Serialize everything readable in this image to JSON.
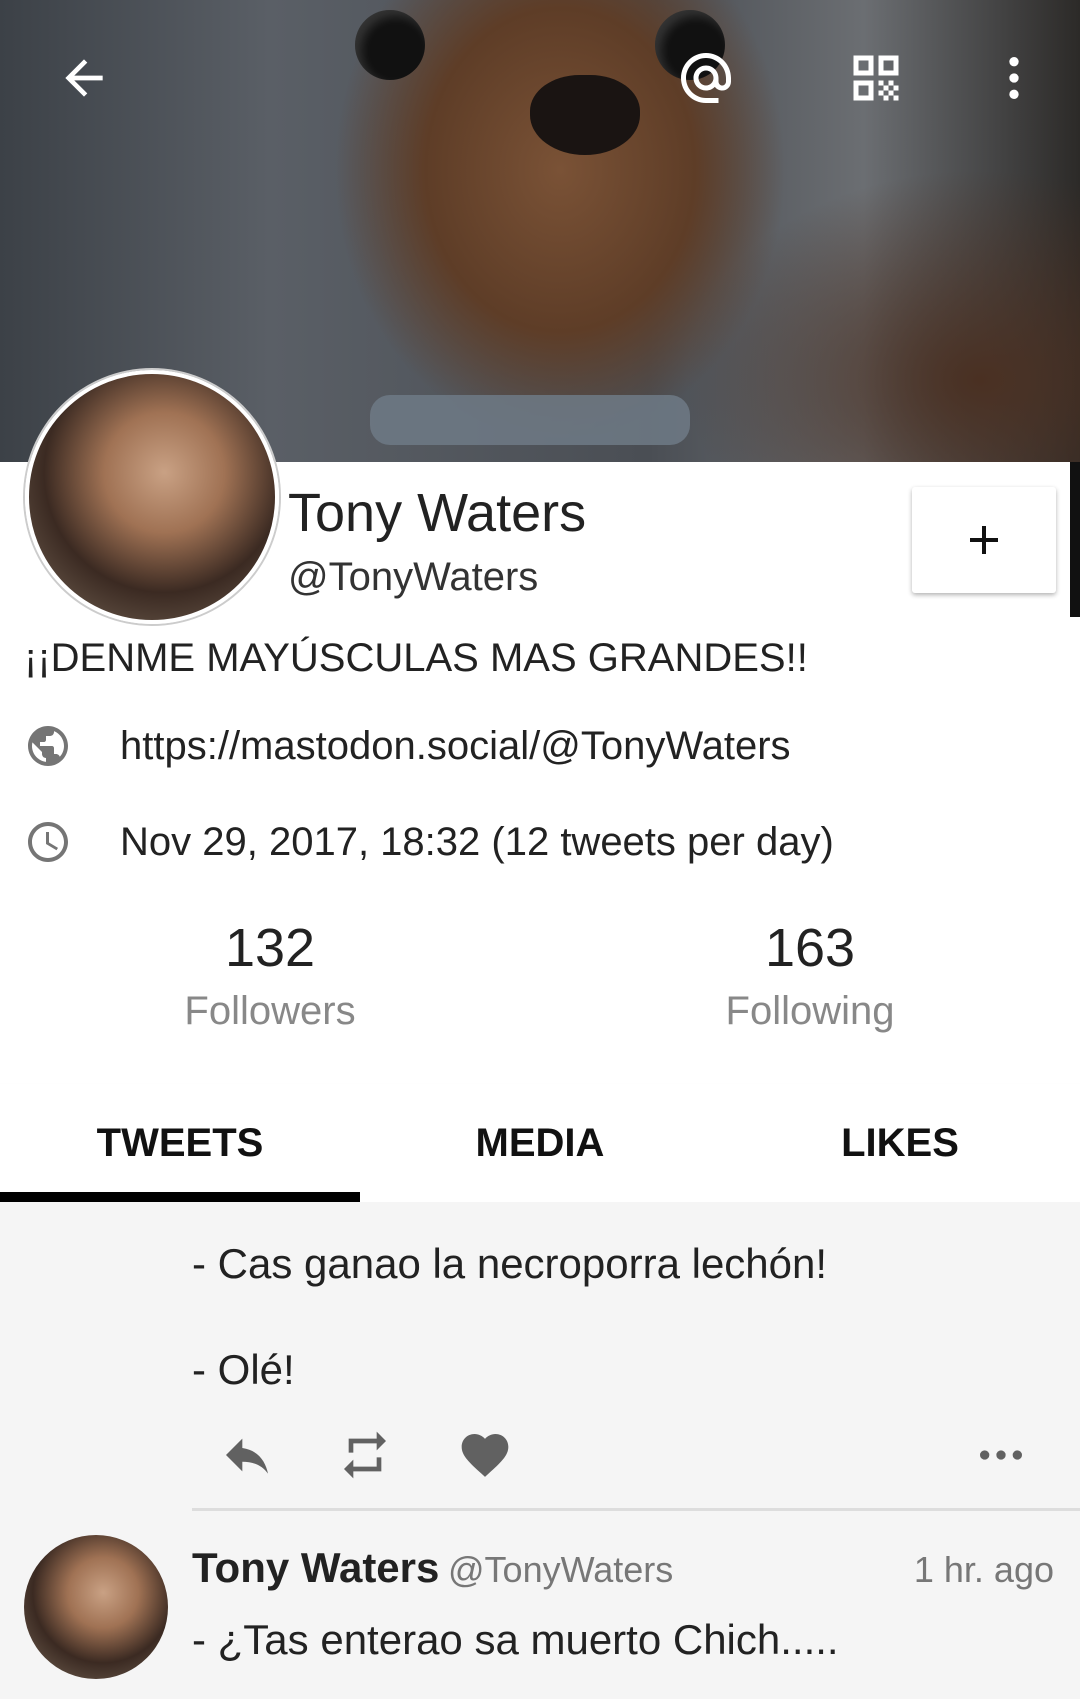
{
  "topbar": {
    "back_icon": "arrow-left-icon",
    "mention_icon": "at-sign-icon",
    "qr_icon": "qr-code-icon",
    "menu_icon": "more-vertical-icon"
  },
  "profile": {
    "display_name": "Tony Waters",
    "handle": "@TonyWaters",
    "follow_button_label": "+",
    "bio": "¡¡DENME MAYÚSCULAS MAS GRANDES!!",
    "website": "https://mastodon.social/@TonyWaters",
    "joined": "Nov 29, 2017, 18:32 (12 tweets per day)"
  },
  "stats": {
    "followers_count": "132",
    "followers_label": "Followers",
    "following_count": "163",
    "following_label": "Following"
  },
  "tabs": [
    {
      "label": "TWEETS",
      "active": true
    },
    {
      "label": "MEDIA",
      "active": false
    },
    {
      "label": "LIKES",
      "active": false
    }
  ],
  "feed": {
    "toot1": {
      "lines": [
        "- Cas ganao la necroporra lechón!",
        "- Olé!"
      ]
    },
    "toot2": {
      "name": "Tony Waters",
      "handle": "@TonyWaters",
      "time": "1 hr. ago",
      "text": "- ¿Tas enterao sa muerto Chich....."
    }
  },
  "colors": {
    "tab_indicator": "#000000",
    "muted_text": "#888888",
    "feed_bg": "#f5f5f5"
  }
}
